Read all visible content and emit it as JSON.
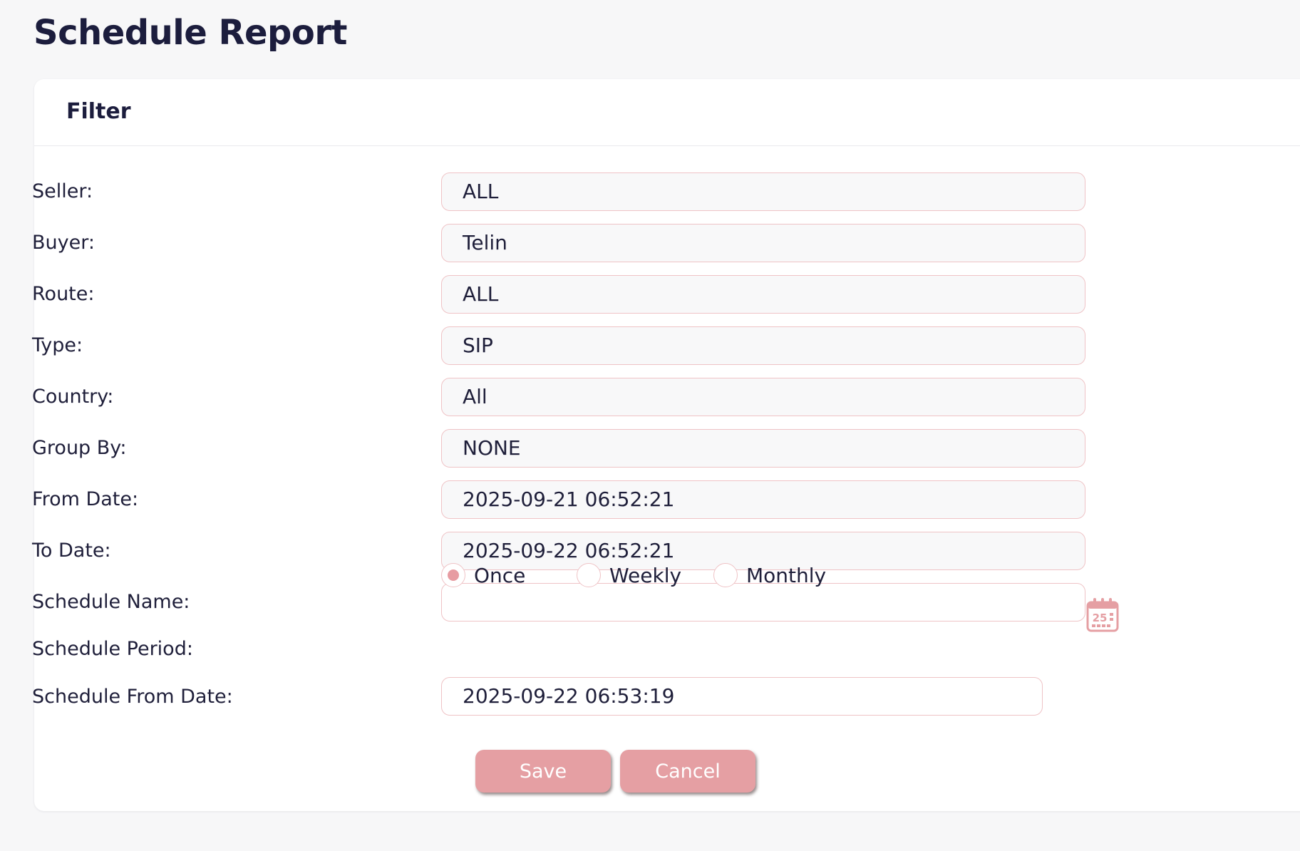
{
  "page": {
    "title": "Schedule Report"
  },
  "filter": {
    "title": "Filter",
    "fields": {
      "seller": {
        "label": "Seller:",
        "value": "ALL"
      },
      "buyer": {
        "label": "Buyer:",
        "value": "Telin"
      },
      "route": {
        "label": "Route:",
        "value": "ALL"
      },
      "type": {
        "label": "Type:",
        "value": "SIP"
      },
      "country": {
        "label": "Country:",
        "value": "All"
      },
      "group_by": {
        "label": "Group By:",
        "value": "NONE"
      },
      "from_date": {
        "label": "From Date:",
        "value": "2025-09-21 06:52:21"
      },
      "to_date": {
        "label": "To Date:",
        "value": "2025-09-22 06:52:21"
      },
      "schedule_name": {
        "label": "Schedule Name:",
        "value": ""
      },
      "schedule_period": {
        "label": "Schedule Period:",
        "options": [
          "Once",
          "Weekly",
          "Monthly"
        ],
        "selected": "Once"
      },
      "schedule_from_date": {
        "label": "Schedule From Date:",
        "value": "2025-09-22 06:53:19"
      }
    },
    "calendar_icon": {
      "name": "calendar-icon",
      "day": "25"
    },
    "buttons": {
      "save": "Save",
      "cancel": "Cancel"
    }
  },
  "colors": {
    "accent": "#e59fa3",
    "field_border": "#efc3c6",
    "title": "#1c1d3d",
    "background": "#f7f7f8"
  }
}
